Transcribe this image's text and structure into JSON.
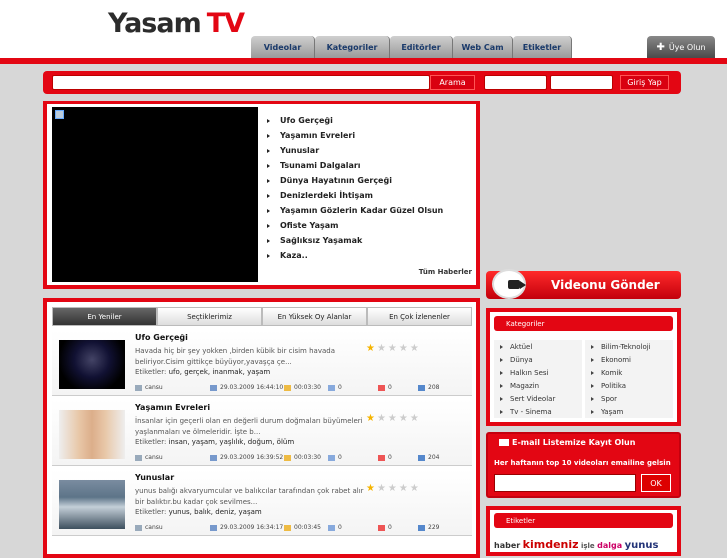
{
  "header": {
    "logo_main": "Yasam",
    "logo_tv": "TV",
    "nav": [
      "Videolar",
      "Kategoriler",
      "Editörler",
      "Web Cam",
      "Etiketler"
    ],
    "signup": "Üye Olun"
  },
  "searchbar": {
    "search_button": "Arama",
    "login_button": "Giriş Yap"
  },
  "player": {
    "playlist": [
      "Ufo Gerçeği",
      "Yaşamın Evreleri",
      "Yunuslar",
      "Tsunami Dalgaları",
      "Dünya Hayatının Gerçeği",
      "Denizlerdeki İhtişam",
      "Yaşamın Gözlerin Kadar Güzel Olsun",
      "Ofiste Yaşam",
      "Sağlıksız Yaşamak",
      "Kaza.."
    ],
    "all_news": "Tüm Haberler"
  },
  "tabs": [
    "En Yeniler",
    "Seçtiklerimiz",
    "En Yüksek Oy Alanlar",
    "En Çok İzlenenler"
  ],
  "videos": [
    {
      "title": "Ufo Gerçeği",
      "desc": "Havada hiç bir şey yokken ,birden kübik bir cisim havada beliriyor.Cisim gittikçe büyüyor,yavaşça çe...",
      "tags_label": "Etiketler:",
      "tags": "ufo, gerçek, inanmak, yaşam",
      "user": "cansu",
      "date": "29.03.2009 16:44:10",
      "duration": "00:03:30",
      "comments": "0",
      "votes": "0",
      "views": "208",
      "rating": 1
    },
    {
      "title": "Yaşamın Evreleri",
      "desc": "İnsanlar için geçerli olan en değerli durum doğmaları büyümeleri yaşlanmaları ve ölmeleridir. İşte b...",
      "tags_label": "Etiketler:",
      "tags": "insan, yaşam, yaşlılık, doğum, ölüm",
      "user": "cansu",
      "date": "29.03.2009 16:39:52",
      "duration": "00:03:30",
      "comments": "0",
      "votes": "0",
      "views": "204",
      "rating": 1
    },
    {
      "title": "Yunuslar",
      "desc": "yunus balığı akvaryumcular ve balıkcılar tarafından çok rabet alır bir balıktır.bu kadar çok sevilmes...",
      "tags_label": "Etiketler:",
      "tags": "yunus, balık, deniz, yaşam",
      "user": "cansu",
      "date": "29.03.2009 16:34:17",
      "duration": "00:03:45",
      "comments": "0",
      "votes": "0",
      "views": "229",
      "rating": 1
    }
  ],
  "send_video": "Videonu Gönder",
  "categories": {
    "title": "Kategoriler",
    "items": [
      "Aktüel",
      "Bilim-Teknoloji",
      "Dünya",
      "Ekonomi",
      "Halkın Sesi",
      "Komik",
      "Magazin",
      "Politika",
      "Sert Videolar",
      "Spor",
      "Tv - Sinema",
      "Yaşam"
    ]
  },
  "newsletter": {
    "title": "E-mail Listemize Kayıt Olun",
    "subtitle": "Her haftanın top 10 videoları emailine gelsin",
    "ok": "OK"
  },
  "tags": {
    "title": "Etiketler",
    "cloud": [
      "haber",
      "kimdeniz",
      "işle",
      "dalga",
      "yunus"
    ]
  },
  "colors": {
    "accent": "#e30613"
  }
}
